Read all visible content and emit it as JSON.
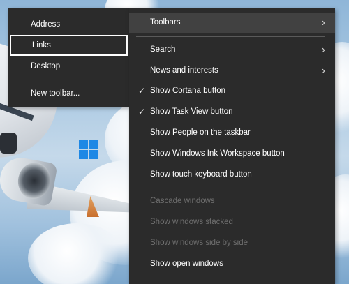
{
  "submenu": {
    "items": [
      {
        "label": "Address",
        "selected": false
      },
      {
        "label": "Links",
        "selected": true
      },
      {
        "label": "Desktop",
        "selected": false
      }
    ],
    "new_toolbar": "New toolbar..."
  },
  "mainmenu": {
    "toolbars": "Toolbars",
    "search": "Search",
    "news": "News and interests",
    "cortana": "Show Cortana button",
    "taskview": "Show Task View button",
    "people": "Show People on the taskbar",
    "ink": "Show Windows Ink Workspace button",
    "touch": "Show touch keyboard button",
    "cascade": "Cascade windows",
    "stacked": "Show windows stacked",
    "sidebyside": "Show windows side by side",
    "open_windows": "Show open windows"
  },
  "icons": {
    "check": "check-icon",
    "arrow": "chevron-right-icon",
    "windows": "windows-logo-icon"
  },
  "colors": {
    "menu_bg": "#2b2b2b",
    "highlight": "#414141",
    "disabled_text": "#6f6f6f",
    "windows_blue": "#1e88e5"
  }
}
